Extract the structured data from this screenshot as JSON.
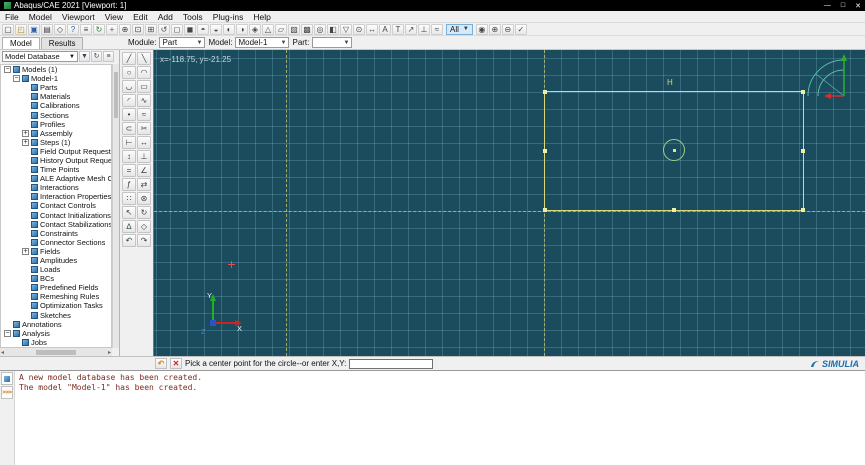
{
  "window": {
    "title": "Abaqus/CAE 2021 [Viewport: 1]",
    "minimize": "—",
    "maximize": "□",
    "close": "✕"
  },
  "menus": [
    "File",
    "Model",
    "Viewport",
    "View",
    "Edit",
    "Add",
    "Tools",
    "Plug-ins",
    "Help"
  ],
  "toolbar_main": {
    "icons_left": [
      {
        "name": "new-model-icon",
        "glyph": "▢"
      },
      {
        "name": "open-model-icon",
        "glyph": "◰",
        "c": "#b8860b"
      },
      {
        "name": "save-model-icon",
        "glyph": "▣",
        "c": "#2f5fa8"
      },
      {
        "name": "print-icon",
        "glyph": "▤"
      },
      {
        "name": "session-objects-icon",
        "glyph": "◇"
      },
      {
        "name": "query-info-icon",
        "glyph": "?",
        "c": "#2f5fa8"
      },
      {
        "name": "macro-manager-icon",
        "glyph": "≡"
      },
      {
        "name": "rotate-view-icon",
        "glyph": "↻",
        "c": "#2e7d32"
      },
      {
        "name": "pan-view-icon",
        "glyph": "+",
        "c": "#2e7d32"
      },
      {
        "name": "magnify-view-icon",
        "glyph": "⊕"
      },
      {
        "name": "box-zoom-icon",
        "glyph": "⊡"
      },
      {
        "name": "auto-fit-icon",
        "glyph": "⊞"
      },
      {
        "name": "cycle-views-icon",
        "glyph": "↺"
      },
      {
        "name": "front-view-icon",
        "glyph": "◻"
      },
      {
        "name": "back-view-icon",
        "glyph": "◼"
      },
      {
        "name": "top-view-icon",
        "glyph": "◓"
      },
      {
        "name": "bottom-view-icon",
        "glyph": "◒"
      },
      {
        "name": "left-view-icon",
        "glyph": "◐"
      },
      {
        "name": "right-view-icon",
        "glyph": "◑"
      },
      {
        "name": "iso-view-icon",
        "glyph": "◈"
      },
      {
        "name": "perspective-icon",
        "glyph": "△"
      },
      {
        "name": "wireframe-render-icon",
        "glyph": "▱"
      },
      {
        "name": "hiddenline-render-icon",
        "glyph": "▨"
      },
      {
        "name": "shaded-render-icon",
        "glyph": "▩"
      },
      {
        "name": "render-style-icon",
        "glyph": "◎"
      },
      {
        "name": "color-code-icon",
        "glyph": "◧"
      },
      {
        "name": "selection-toggle-icon",
        "glyph": "▽"
      },
      {
        "name": "probe-values-icon",
        "glyph": "⊙"
      },
      {
        "name": "measure-icon",
        "glyph": "↔"
      },
      {
        "name": "annotation-icon",
        "glyph": "A"
      },
      {
        "name": "text-annotation-icon",
        "glyph": "T"
      },
      {
        "name": "arrow-annotation-icon",
        "glyph": "↗"
      },
      {
        "name": "coordinate-system-icon",
        "glyph": "⊥"
      },
      {
        "name": "options-icon",
        "glyph": "≈"
      }
    ],
    "display_group_selector": "All",
    "icons_right": [
      {
        "name": "replace-displaygroup-icon",
        "glyph": "◉"
      },
      {
        "name": "add-displaygroup-icon",
        "glyph": "⊕"
      },
      {
        "name": "remove-displaygroup-icon",
        "glyph": "⊖"
      },
      {
        "name": "intersect-displaygroup-icon",
        "glyph": "✓"
      }
    ]
  },
  "context_bar": {
    "tabs": [
      {
        "label": "Model",
        "name": "tab-model",
        "active": true
      },
      {
        "label": "Results",
        "name": "tab-results"
      }
    ],
    "module_label": "Module:",
    "module_value": "Part",
    "model_label": "Model:",
    "model_value": "Model-1",
    "part_label": "Part:",
    "part_value": ""
  },
  "tree": {
    "database_label": "Model Database",
    "header_icons": [
      {
        "name": "tree-filter-icon",
        "glyph": "▼"
      },
      {
        "name": "tree-refresh-icon",
        "glyph": "↻"
      },
      {
        "name": "tree-options-icon",
        "glyph": "≡"
      }
    ],
    "items": [
      {
        "label": "Models (1)",
        "level": 0,
        "exp": "−",
        "name": "tree-models"
      },
      {
        "label": "Model-1",
        "level": 1,
        "exp": "−",
        "name": "tree-model-1"
      },
      {
        "label": "Parts",
        "level": 2,
        "name": "tree-parts"
      },
      {
        "label": "Materials",
        "level": 2,
        "name": "tree-materials"
      },
      {
        "label": "Calibrations",
        "level": 2,
        "name": "tree-calibrations"
      },
      {
        "label": "Sections",
        "level": 2,
        "name": "tree-sections"
      },
      {
        "label": "Profiles",
        "level": 2,
        "name": "tree-profiles"
      },
      {
        "label": "Assembly",
        "level": 2,
        "exp": "+",
        "name": "tree-assembly"
      },
      {
        "label": "Steps (1)",
        "level": 2,
        "exp": "+",
        "name": "tree-steps"
      },
      {
        "label": "Field Output Requests",
        "level": 2,
        "name": "tree-field-output-requests"
      },
      {
        "label": "History Output Requests",
        "level": 2,
        "name": "tree-history-output-requests"
      },
      {
        "label": "Time Points",
        "level": 2,
        "name": "tree-time-points"
      },
      {
        "label": "ALE Adaptive Mesh Constraint",
        "level": 2,
        "name": "tree-ale-adaptive-mesh-constraints"
      },
      {
        "label": "Interactions",
        "level": 2,
        "name": "tree-interactions"
      },
      {
        "label": "Interaction Properties",
        "level": 2,
        "name": "tree-interaction-properties"
      },
      {
        "label": "Contact Controls",
        "level": 2,
        "name": "tree-contact-controls"
      },
      {
        "label": "Contact Initializations",
        "level": 2,
        "name": "tree-contact-initializations"
      },
      {
        "label": "Contact Stabilizations",
        "level": 2,
        "name": "tree-contact-stabilizations"
      },
      {
        "label": "Constraints",
        "level": 2,
        "name": "tree-constraints"
      },
      {
        "label": "Connector Sections",
        "level": 2,
        "name": "tree-connector-sections"
      },
      {
        "label": "Fields",
        "level": 2,
        "exp": "+",
        "name": "tree-fields"
      },
      {
        "label": "Amplitudes",
        "level": 2,
        "name": "tree-amplitudes"
      },
      {
        "label": "Loads",
        "level": 2,
        "name": "tree-loads"
      },
      {
        "label": "BCs",
        "level": 2,
        "name": "tree-bcs"
      },
      {
        "label": "Predefined Fields",
        "level": 2,
        "name": "tree-predefined-fields"
      },
      {
        "label": "Remeshing Rules",
        "level": 2,
        "name": "tree-remeshing-rules"
      },
      {
        "label": "Optimization Tasks",
        "level": 2,
        "name": "tree-optimization-tasks"
      },
      {
        "label": "Sketches",
        "level": 2,
        "name": "tree-sketches"
      },
      {
        "label": "Annotations",
        "level": 0,
        "name": "tree-annotations"
      },
      {
        "label": "Analysis",
        "level": 0,
        "exp": "−",
        "name": "tree-analysis"
      },
      {
        "label": "Jobs",
        "level": 1,
        "name": "tree-jobs"
      }
    ]
  },
  "toolbox": {
    "tools": [
      {
        "name": "line-tool",
        "glyph": "╱"
      },
      {
        "name": "construction-line-tool",
        "glyph": "╲"
      },
      {
        "name": "circle-tool",
        "glyph": "○"
      },
      {
        "name": "arc-3points-tool",
        "glyph": "◠"
      },
      {
        "name": "arc-center-ends-tool",
        "glyph": "◡"
      },
      {
        "name": "rectangle-tool",
        "glyph": "▭"
      },
      {
        "name": "fillet-tool",
        "glyph": "◜"
      },
      {
        "name": "spline-tool",
        "glyph": "∿"
      },
      {
        "name": "point-tool",
        "glyph": "•"
      },
      {
        "name": "offset-tool",
        "glyph": "≈"
      },
      {
        "name": "project-edges-tool",
        "glyph": "⊂"
      },
      {
        "name": "auto-trim-tool",
        "glyph": "✂"
      },
      {
        "name": "trim-extend-tool",
        "glyph": "⊢"
      },
      {
        "name": "dimension-tool",
        "glyph": "↔"
      },
      {
        "name": "edit-dimension-tool",
        "glyph": "↕"
      },
      {
        "name": "constraint-tool",
        "glyph": "⊥"
      },
      {
        "name": "equal-constraint-tool",
        "glyph": "="
      },
      {
        "name": "angle-constraint-tool",
        "glyph": "∠"
      },
      {
        "name": "parameter-manager-tool",
        "glyph": "ƒ"
      },
      {
        "name": "mirror-tool",
        "glyph": "⇄"
      },
      {
        "name": "linear-pattern-tool",
        "glyph": "∷"
      },
      {
        "name": "radial-pattern-tool",
        "glyph": "⊛"
      },
      {
        "name": "translate-tool",
        "glyph": "↖"
      },
      {
        "name": "rotate-tool",
        "glyph": "↻"
      },
      {
        "name": "scale-tool",
        "glyph": "∆"
      },
      {
        "name": "drag-entities-tool",
        "glyph": "◇"
      },
      {
        "name": "undo-tool",
        "glyph": "↶"
      },
      {
        "name": "redo-tool",
        "glyph": "↷"
      }
    ]
  },
  "viewport": {
    "coords": "x=-118.75, y=-21.25",
    "h_constraint": "H",
    "axis_x": "X",
    "axis_y": "Y",
    "axis_z": "Z"
  },
  "prompt": {
    "back": "↶",
    "cancel": "✕",
    "text": "Pick a center point for the circle--or enter X,Y:",
    "value": ""
  },
  "messages": {
    "lines": [
      "A new model database has been created.",
      "The model \"Model-1\" has been created."
    ],
    "cli_prompt": ">>>"
  },
  "brand": {
    "name": "SIMULIA"
  }
}
